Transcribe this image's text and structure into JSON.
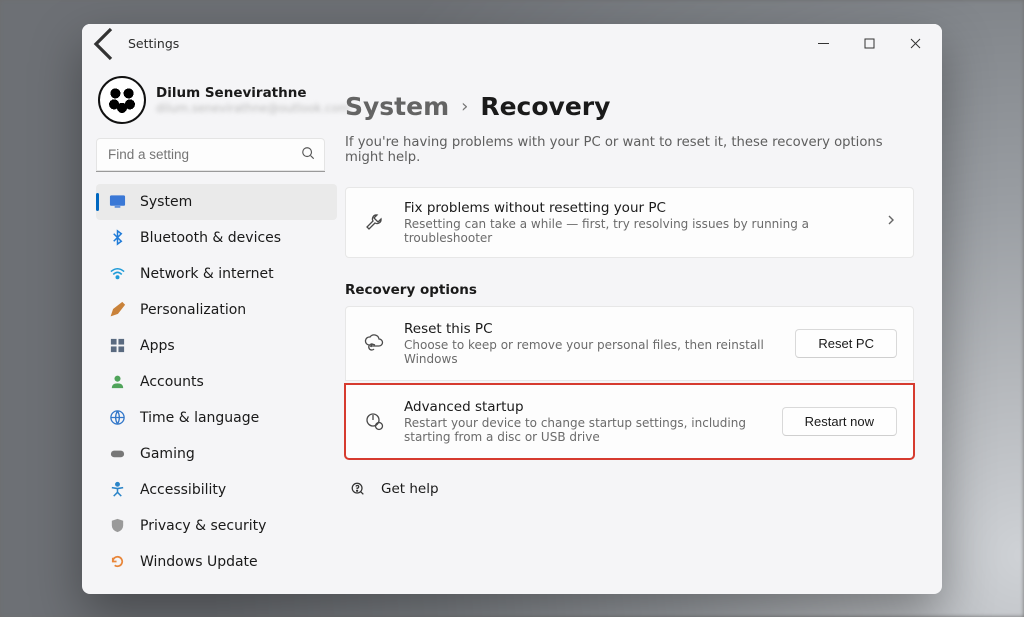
{
  "titlebar": {
    "app_name": "Settings"
  },
  "profile": {
    "name": "Dilum Senevirathne",
    "email": "dilum.senevirathne@outlook.com"
  },
  "search": {
    "placeholder": "Find a setting"
  },
  "sidebar": {
    "items": [
      {
        "label": "System"
      },
      {
        "label": "Bluetooth & devices"
      },
      {
        "label": "Network & internet"
      },
      {
        "label": "Personalization"
      },
      {
        "label": "Apps"
      },
      {
        "label": "Accounts"
      },
      {
        "label": "Time & language"
      },
      {
        "label": "Gaming"
      },
      {
        "label": "Accessibility"
      },
      {
        "label": "Privacy & security"
      },
      {
        "label": "Windows Update"
      }
    ]
  },
  "breadcrumb": {
    "parent": "System",
    "current": "Recovery"
  },
  "page_subtext": "If you're having problems with your PC or want to reset it, these recovery options might help.",
  "troubleshoot": {
    "title": "Fix problems without resetting your PC",
    "desc": "Resetting can take a while — first, try resolving issues by running a troubleshooter"
  },
  "recovery_section_label": "Recovery options",
  "reset": {
    "title": "Reset this PC",
    "desc": "Choose to keep or remove your personal files, then reinstall Windows",
    "button": "Reset PC"
  },
  "advanced": {
    "title": "Advanced startup",
    "desc": "Restart your device to change startup settings, including starting from a disc or USB drive",
    "button": "Restart now"
  },
  "help": {
    "label": "Get help"
  }
}
